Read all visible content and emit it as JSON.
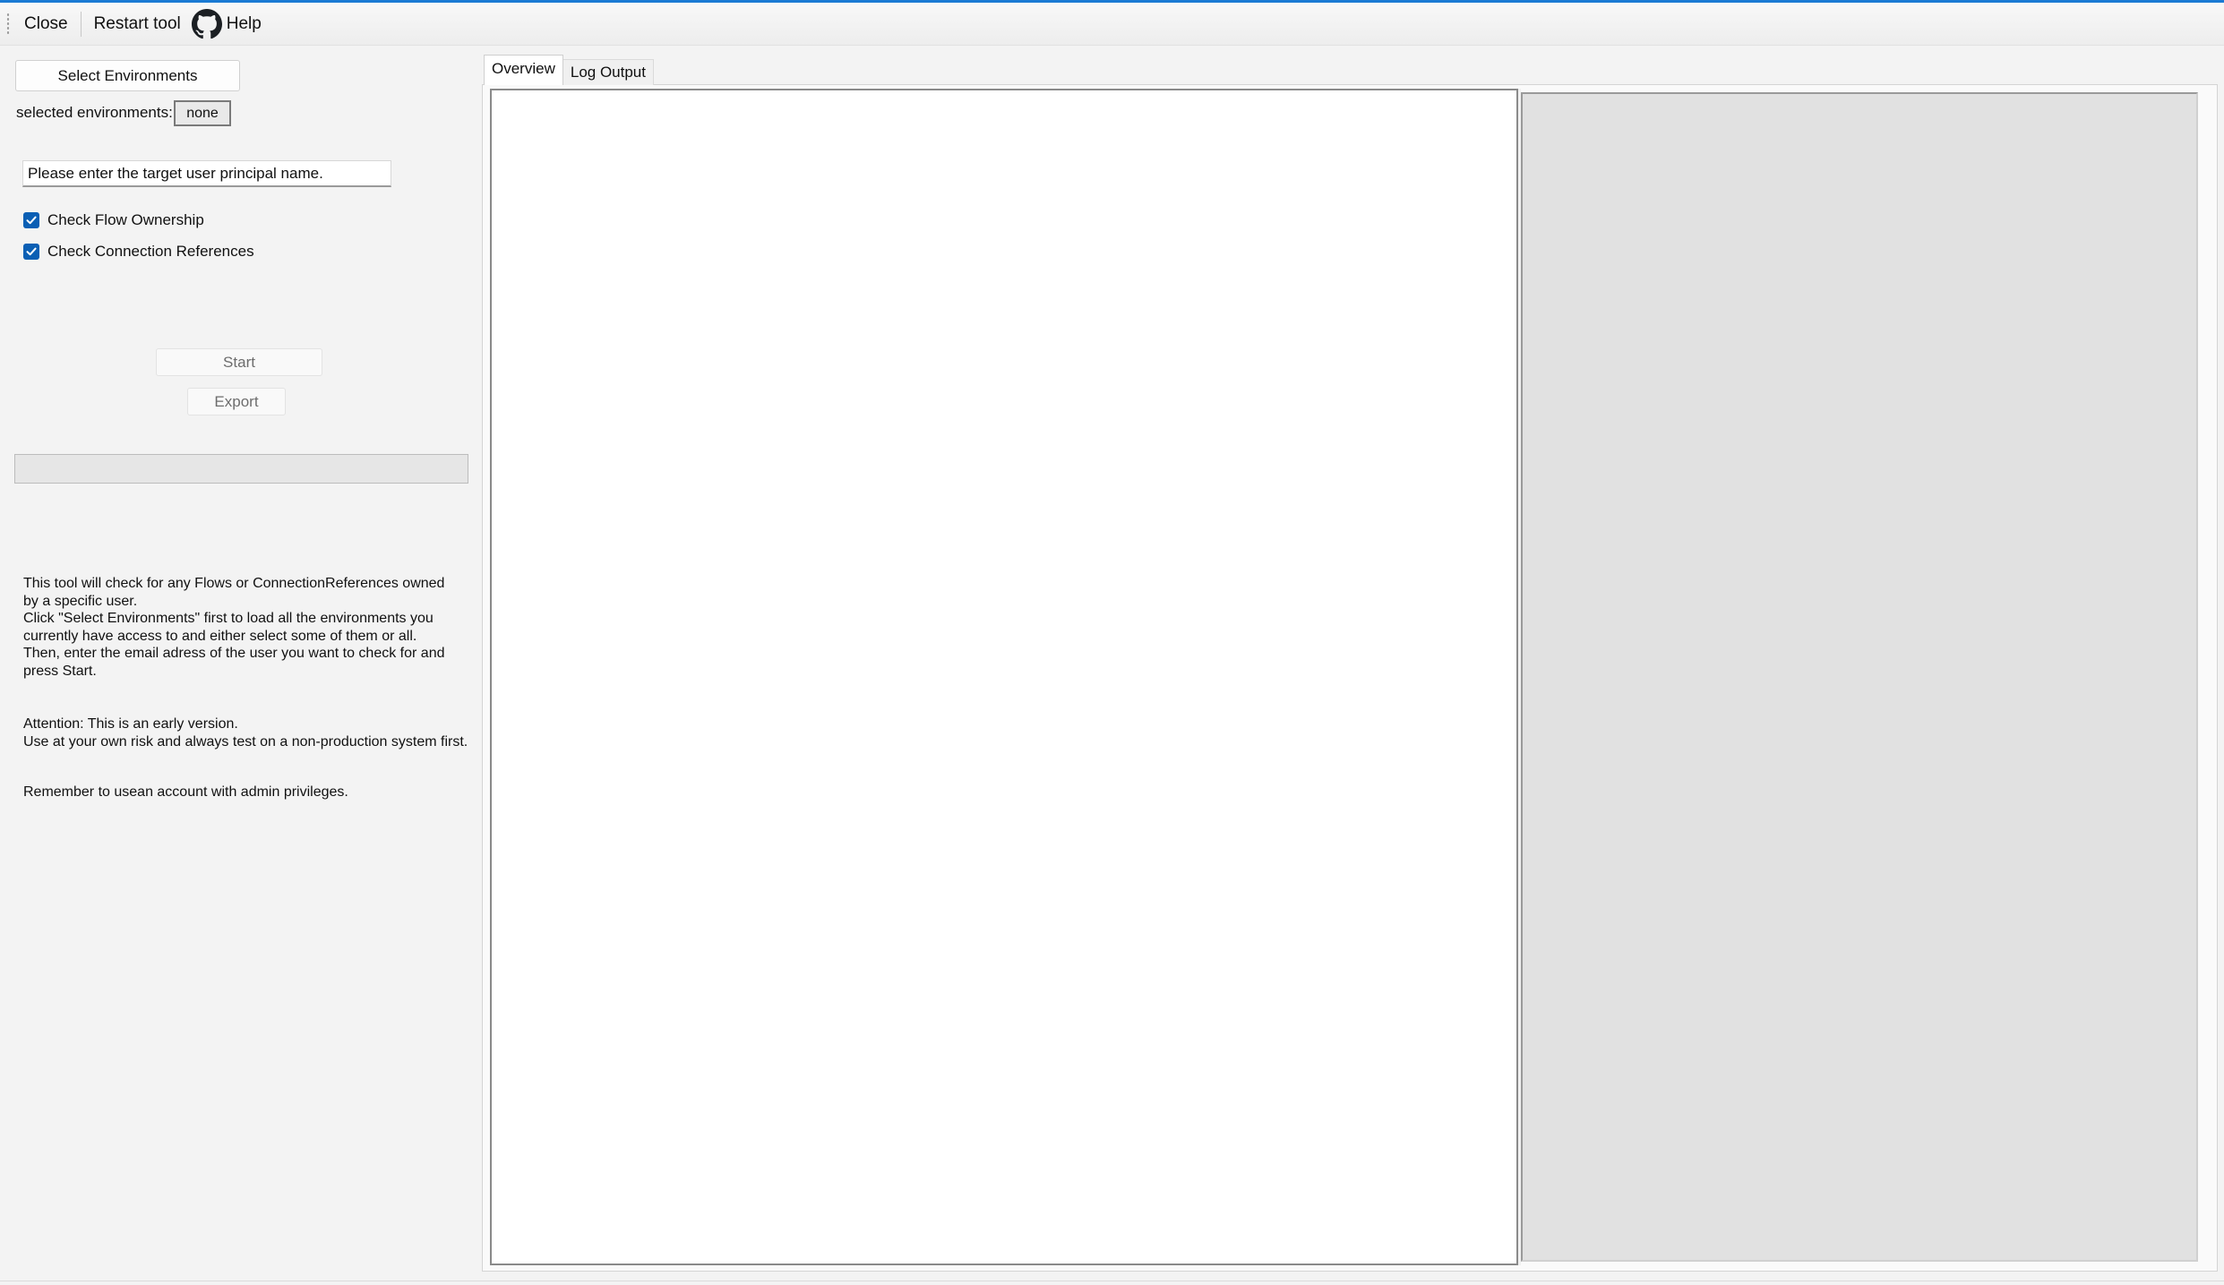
{
  "toolbar": {
    "close_label": "Close",
    "restart_label": "Restart tool",
    "help_label": "Help"
  },
  "left_panel": {
    "select_env_label": "Select Environments",
    "selected_env_label": "selected environments:",
    "selected_env_value": "none",
    "upn_input_value": "Please enter the target user principal name.",
    "check_flow_label": "Check Flow Ownership",
    "check_flow_checked": true,
    "check_conn_label": "Check Connection References",
    "check_conn_checked": true,
    "start_label": "Start",
    "export_label": "Export",
    "description": "This tool will check for any Flows or ConnectionReferences owned\nby a specific user.\nClick \"Select Environments\" first to load all the environments you\ncurrently have access to and either select some of them or all.\nThen, enter the email adress of the user you want to check for and\npress Start.",
    "attention": "Attention: This is an early version.\nUse at your own risk and always test on a non-production system first.",
    "reminder": "Remember to usean account with admin privileges."
  },
  "tabs": [
    {
      "label": "Overview",
      "active": true
    },
    {
      "label": "Log Output",
      "active": false
    }
  ],
  "colors": {
    "accent": "#1a7ad4",
    "checkbox": "#0a5fb4"
  }
}
